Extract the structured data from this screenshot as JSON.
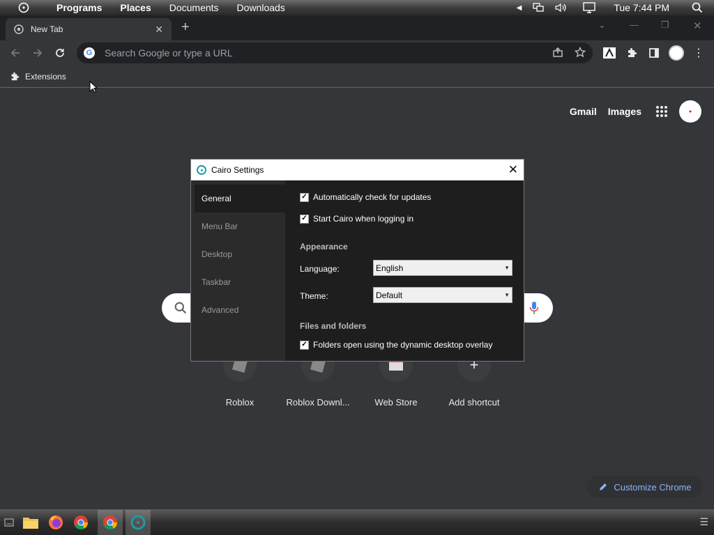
{
  "menubar": {
    "items": [
      "Programs",
      "Places",
      "Documents",
      "Downloads"
    ],
    "clock": "Tue 7:44 PM"
  },
  "browser": {
    "tab_title": "New Tab",
    "omnibox_placeholder": "Search Google or type a URL",
    "bookmark": "Extensions",
    "ntp": {
      "gmail": "Gmail",
      "images": "Images",
      "shortcuts": [
        "Roblox",
        "Roblox Downl...",
        "Web Store",
        "Add shortcut"
      ],
      "customize": "Customize Chrome"
    }
  },
  "dialog": {
    "title": "Cairo Settings",
    "nav": [
      "General",
      "Menu Bar",
      "Desktop",
      "Taskbar",
      "Advanced"
    ],
    "auto_update": "Automatically check for updates",
    "start_on_login": "Start Cairo when logging in",
    "appearance_header": "Appearance",
    "language_label": "Language:",
    "language_value": "English",
    "theme_label": "Theme:",
    "theme_value": "Default",
    "files_header": "Files and folders",
    "folders_option": "Folders open using the dynamic desktop overlay"
  },
  "colors": {
    "chrome_bg": "#35363a",
    "accent": "#8ab4f8",
    "cairo_teal": "#1e9aa0"
  }
}
